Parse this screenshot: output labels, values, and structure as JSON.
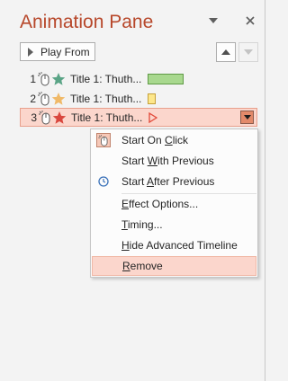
{
  "pane": {
    "title": "Animation Pane",
    "play_from_label": "Play From",
    "icons": {
      "options": "triangle-down-icon",
      "close": "close-icon",
      "move_up": "up-arrow-icon",
      "move_down": "down-arrow-icon"
    }
  },
  "animations": [
    {
      "number": "1",
      "title": "Title 1: Thuth...",
      "star_color": "#5aa486",
      "effect": "entrance",
      "bar_color": "#a8d88e",
      "bar_border": "#5f9a45"
    },
    {
      "number": "2",
      "title": "Title 1: Thuth...",
      "star_color": "#f0b968",
      "effect": "emphasis",
      "bar_color": "#fde78b",
      "bar_border": "#c5a039"
    },
    {
      "number": "3",
      "title": "Title 1: Thuth...",
      "star_color": "#d9473e",
      "effect": "exit",
      "selected": true,
      "marker_color": "#e24a3a"
    }
  ],
  "context_menu": {
    "start_on_click": {
      "before": "Start On ",
      "key": "C",
      "after": "lick",
      "checked": true
    },
    "start_with_previous": {
      "before": "Start ",
      "key": "W",
      "after": "ith Previous"
    },
    "start_after_previous": {
      "before": "Start ",
      "key": "A",
      "after": "fter Previous"
    },
    "effect_options": {
      "key": "E",
      "after": "ffect Options..."
    },
    "timing": {
      "key": "T",
      "after": "iming..."
    },
    "hide_advanced_timeline": {
      "key": "H",
      "after": "ide Advanced Timeline"
    },
    "remove": {
      "key": "R",
      "after": "emove",
      "hovered": true
    }
  },
  "colors": {
    "accent": "#b7472a",
    "selection": "#fbd6cc",
    "pane_bg": "#f3f3f3"
  }
}
